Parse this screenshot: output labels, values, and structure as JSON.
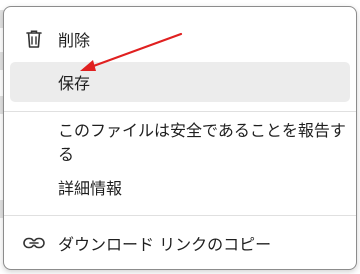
{
  "menu": {
    "items": [
      {
        "label": "削除",
        "icon": "trash-icon"
      },
      {
        "label": "保存",
        "icon": "",
        "state": "hover"
      },
      {
        "label": "このファイルは安全であることを報告する",
        "icon": ""
      },
      {
        "label": "詳細情報",
        "icon": ""
      },
      {
        "label": "ダウンロード リンクのコピー",
        "icon": "link-icon"
      }
    ]
  },
  "annotation": {
    "color": "#e02020",
    "points_to": "保存"
  },
  "colors": {
    "hover_background": "#ececec",
    "border": "#8c8c8c",
    "text": "#1f1f1f"
  }
}
